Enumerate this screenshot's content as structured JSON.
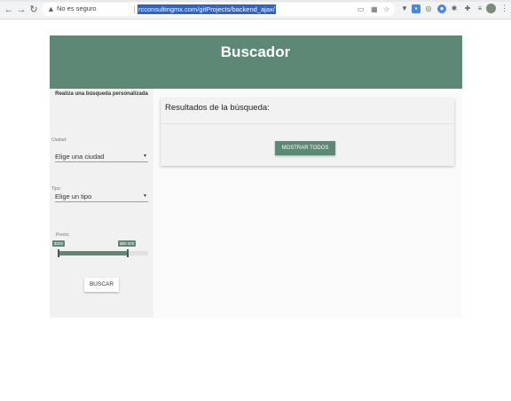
{
  "browser": {
    "security_label": "No es seguro",
    "url": "rcconsultingmx.com/gitProjects/backend_ajax/"
  },
  "page": {
    "title": "Buscador",
    "sidebar": {
      "heading": "Realiza una búsqueda personalizada",
      "city_label": "Ciudad:",
      "city_value": "Elige una ciudad",
      "type_label": "Tipo:",
      "type_value": "Elige un tipo",
      "price_label": "Precio:",
      "price_min": "$200",
      "price_max": "$80 000",
      "search_button": "BUSCAR"
    },
    "results": {
      "title": "Resultados de la búsqueda:",
      "show_all_button": "MOSTRAR TODOS"
    }
  },
  "colors": {
    "accent": "#5d8876",
    "selection": "#2f63c8"
  }
}
